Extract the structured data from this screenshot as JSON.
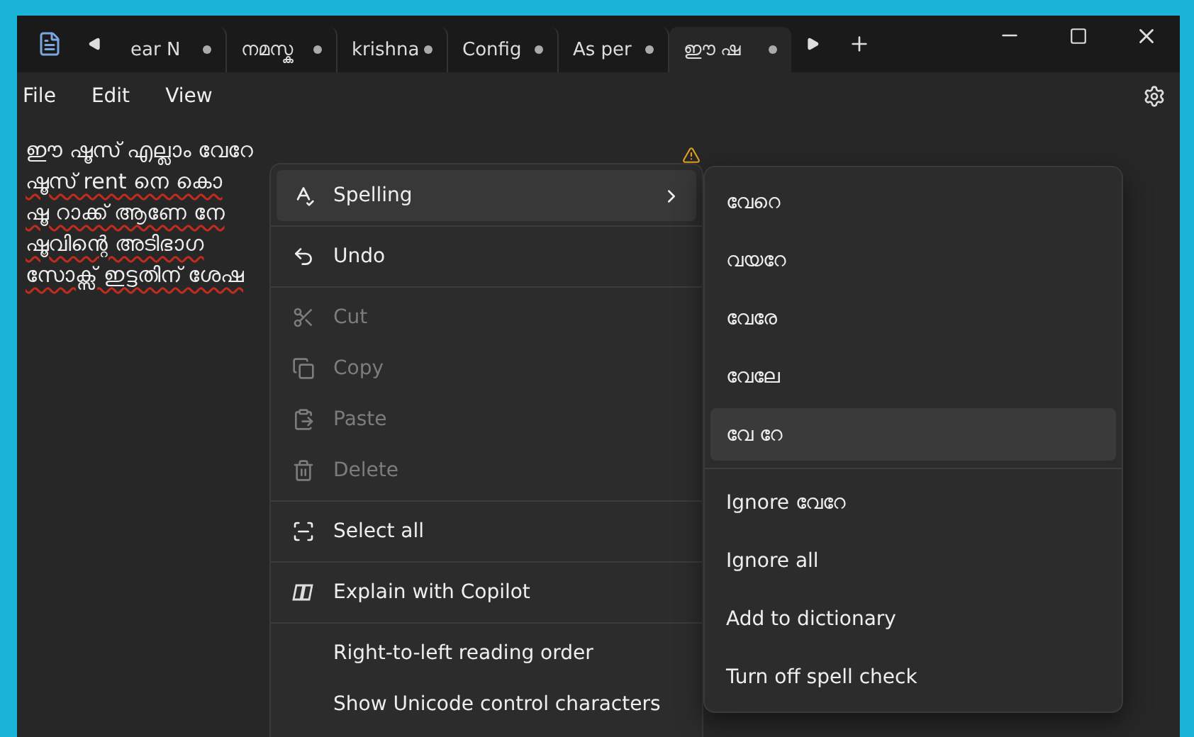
{
  "tabs": [
    {
      "label": "ear N",
      "selected": false,
      "unsaved": true
    },
    {
      "label": "നമസ്ക",
      "selected": false,
      "unsaved": true
    },
    {
      "label": "krishna",
      "selected": false,
      "unsaved": true
    },
    {
      "label": "Config",
      "selected": false,
      "unsaved": true
    },
    {
      "label": "As per",
      "selected": false,
      "unsaved": true
    },
    {
      "label": "ഈ ഷ",
      "selected": true,
      "unsaved": true
    }
  ],
  "menu_bar": [
    "File",
    "Edit",
    "View"
  ],
  "editor_lines": [
    {
      "text": "ഈ ഷൂസ് എല്ലാം വേറേ",
      "misspelled": false
    },
    {
      "text": "ഷൂസ് rent നെ കൊ",
      "misspelled": true
    },
    {
      "text": "ഷൂ റാക്ക് ആണേ നേ",
      "misspelled": true
    },
    {
      "text": "ഷൂവിന്റെ അടിഭാഗ",
      "misspelled": true
    },
    {
      "text": "സോക്സ് ഇട്ടതിന് ശേഷ",
      "misspelled": true
    }
  ],
  "context_menu": [
    {
      "kind": "spelling",
      "label": "Spelling",
      "disabled": false,
      "selected": true
    },
    {
      "kind": "undo",
      "label": "Undo",
      "disabled": false,
      "selected": false
    },
    {
      "kind": "cut",
      "label": "Cut",
      "disabled": true,
      "selected": false
    },
    {
      "kind": "copy",
      "label": "Copy",
      "disabled": true,
      "selected": false
    },
    {
      "kind": "paste",
      "label": "Paste",
      "disabled": true,
      "selected": false
    },
    {
      "kind": "delete",
      "label": "Delete",
      "disabled": true,
      "selected": false
    },
    {
      "kind": "selectall",
      "label": "Select all",
      "disabled": false,
      "selected": false
    },
    {
      "kind": "copilot",
      "label": "Explain with Copilot",
      "disabled": false,
      "selected": false
    },
    {
      "kind": "plain",
      "label": "Right-to-left reading order",
      "disabled": false,
      "selected": false
    },
    {
      "kind": "plain",
      "label": "Show Unicode control characters",
      "disabled": false,
      "selected": false
    }
  ],
  "spelling_submenu": {
    "suggestions": [
      {
        "label": "വേറെ",
        "selected": false
      },
      {
        "label": "വയറേ",
        "selected": false
      },
      {
        "label": "വേരേ",
        "selected": false
      },
      {
        "label": "വേലേ",
        "selected": false
      },
      {
        "label": "വേ റേ",
        "selected": true
      }
    ],
    "actions": [
      "Ignore വേറേ",
      "Ignore all",
      "Add to dictionary",
      "Turn off spell check"
    ]
  }
}
